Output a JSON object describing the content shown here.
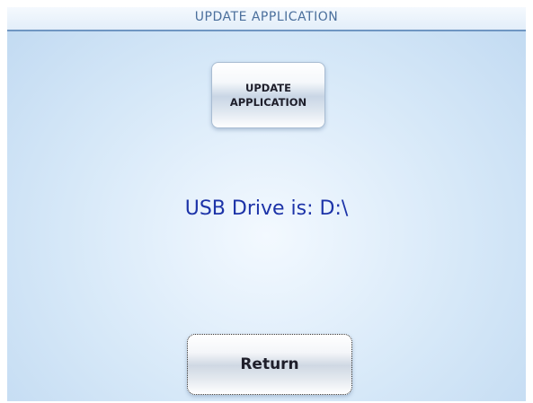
{
  "window": {
    "title": "UPDATE APPLICATION"
  },
  "buttons": {
    "update_label": "UPDATE\nAPPLICATION",
    "return_label": "Return"
  },
  "status": {
    "usb_drive_text": "USB Drive is: D:\\"
  },
  "colors": {
    "title_text": "#4b6f9c",
    "title_rule": "#6f96c2",
    "status_text": "#1c33a8",
    "background": "#d6e8f8"
  }
}
